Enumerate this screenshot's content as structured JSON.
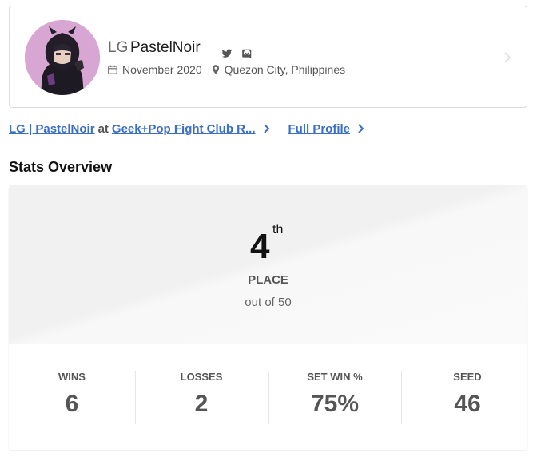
{
  "profile": {
    "prefix": "LG",
    "gamertag": "PastelNoir",
    "joined": "November 2020",
    "location": "Quezon City, Philippines",
    "social_icons": [
      "twitter-icon",
      "discord-icon"
    ]
  },
  "links": {
    "player_link": "LG | PastelNoir",
    "at_text": "at",
    "event_link": "Geek+Pop Fight Club R...",
    "full_profile": "Full Profile"
  },
  "stats_overview": {
    "title": "Stats Overview",
    "placement_number": "4",
    "placement_suffix": "th",
    "placement_label": "PLACE",
    "out_of": "out of 50",
    "stats": [
      {
        "label": "WINS",
        "value": "6"
      },
      {
        "label": "LOSSES",
        "value": "2"
      },
      {
        "label": "SET WIN %",
        "value": "75%"
      },
      {
        "label": "SEED",
        "value": "46"
      }
    ]
  },
  "colors": {
    "link": "#3b6fc4",
    "avatar_bg": "#d7a6d3"
  }
}
